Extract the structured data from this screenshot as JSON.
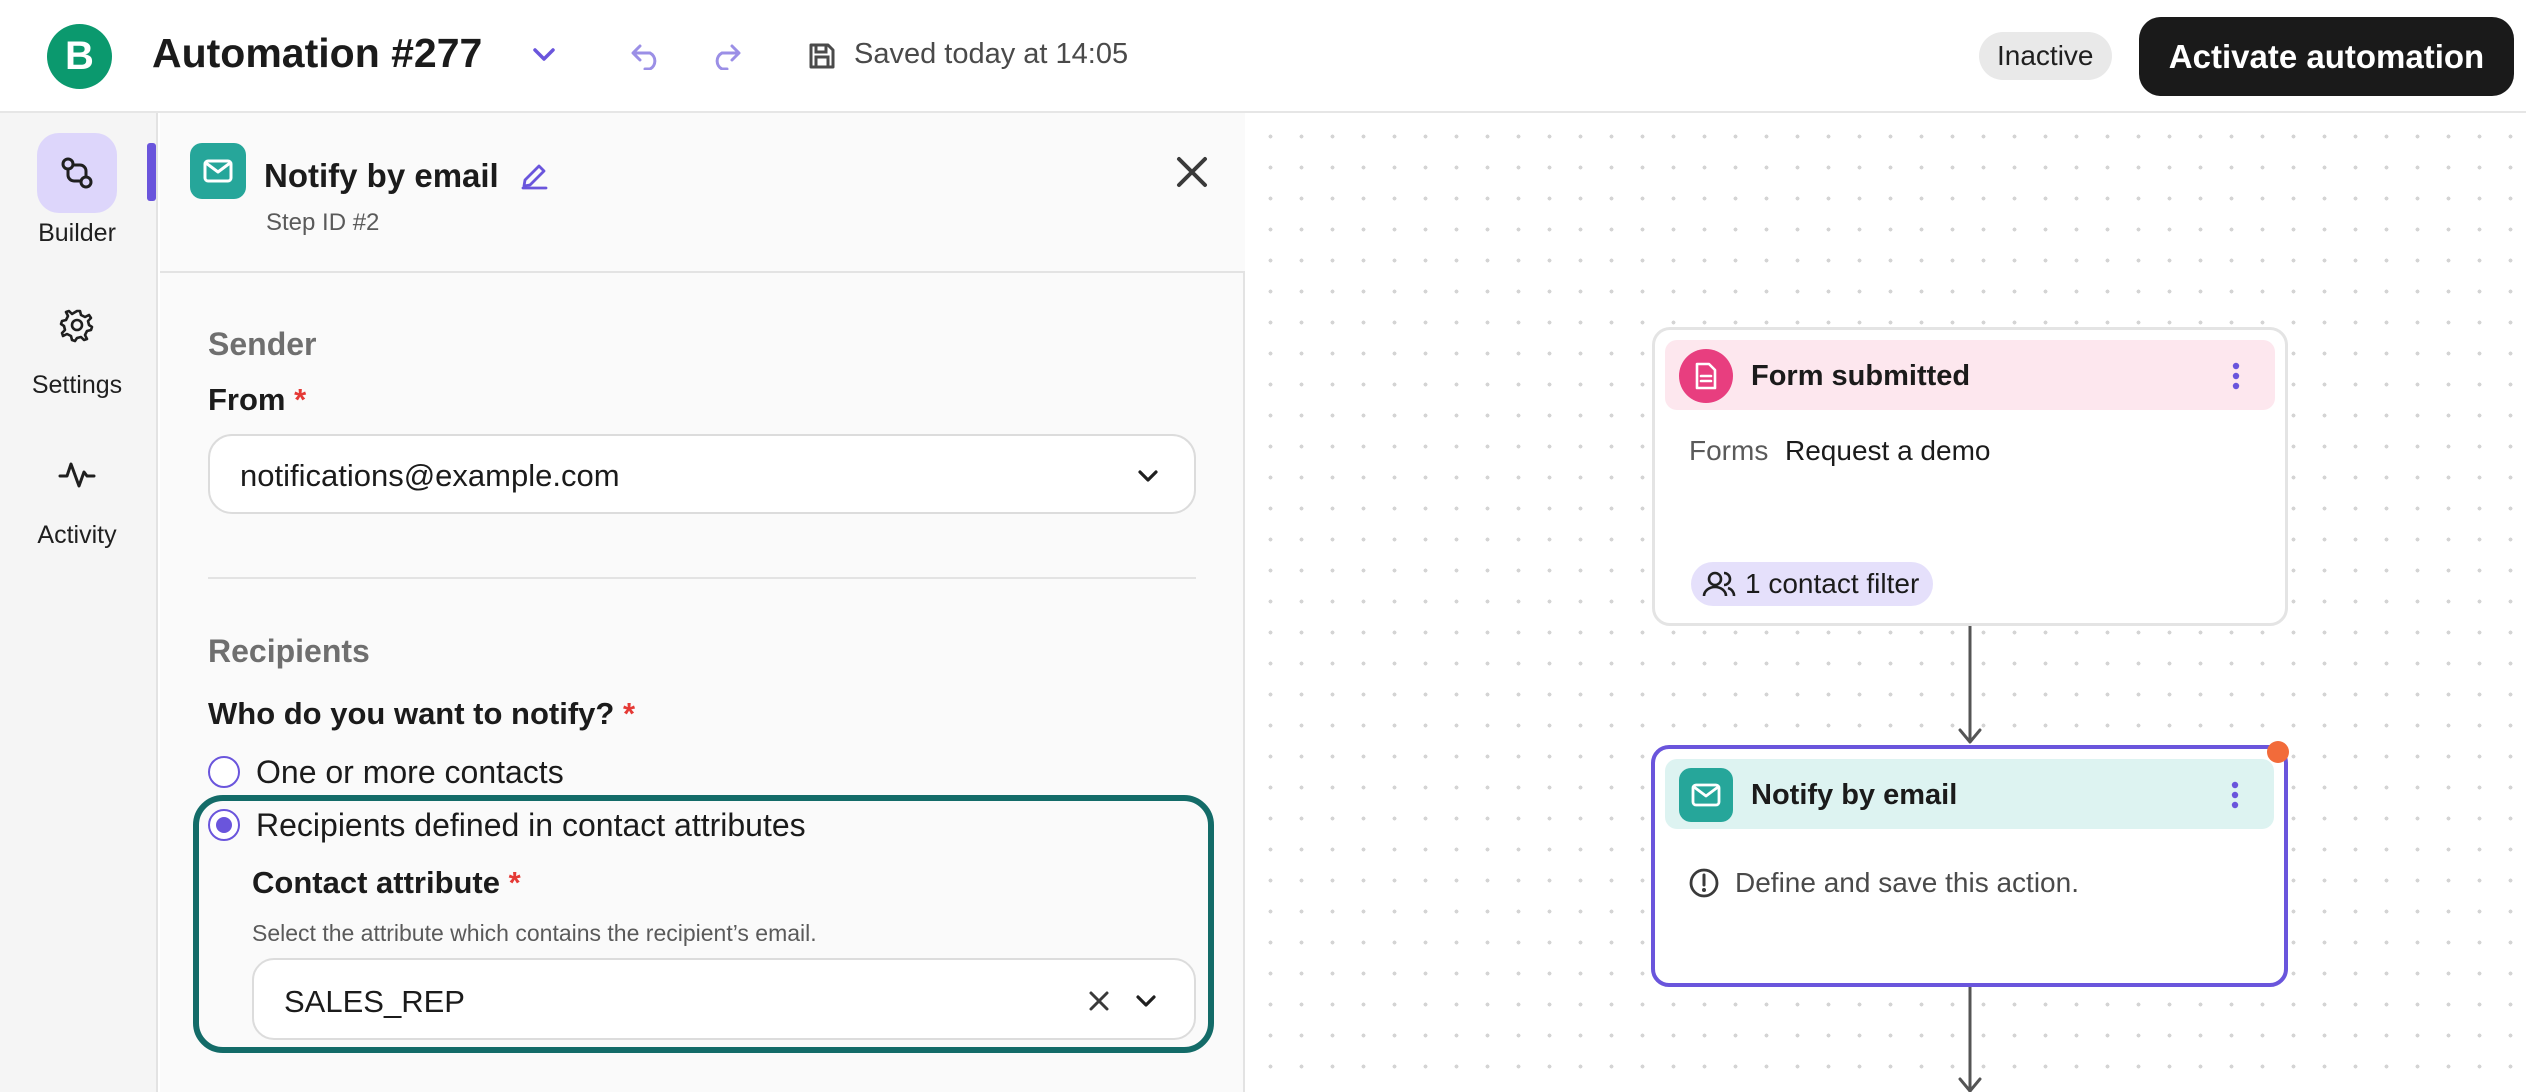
{
  "header": {
    "logo_letter": "B",
    "title": "Automation #277",
    "saved_text": "Saved today at 14:05",
    "status_badge": "Inactive",
    "activate_label": "Activate automation"
  },
  "nav": {
    "items": [
      {
        "label": "Builder",
        "icon": "builder-icon",
        "active": true
      },
      {
        "label": "Settings",
        "icon": "gear-icon",
        "active": false
      },
      {
        "label": "Activity",
        "icon": "activity-icon",
        "active": false
      }
    ]
  },
  "panel": {
    "title": "Notify by email",
    "step_id": "Step ID #2",
    "sender": {
      "section_title": "Sender",
      "from_label": "From",
      "from_value": "notifications@example.com"
    },
    "recipients": {
      "section_title": "Recipients",
      "question": "Who do you want to notify?",
      "options": [
        {
          "label": "One or more contacts",
          "selected": false
        },
        {
          "label": "Recipients defined in contact attributes",
          "selected": true
        }
      ],
      "attribute_label": "Contact attribute",
      "attribute_help": "Select the attribute which contains the recipient’s email.",
      "attribute_value": "SALES_REP"
    },
    "required_marker": "*"
  },
  "canvas": {
    "nodes": [
      {
        "title": "Form submitted",
        "icon": "form-icon",
        "key": "Forms",
        "value": "Request a demo",
        "filter": "1 contact filter"
      },
      {
        "title": "Notify by email",
        "icon": "mail-icon",
        "warning": "Define and save this action."
      }
    ]
  },
  "colors": {
    "accent": "#6a55dc",
    "brand": "#0b996e",
    "highlight_border": "#136b68",
    "form_node_accent": "#e83e7f",
    "mail_node_accent": "#26a69a",
    "unsaved_dot": "#f26b3a"
  }
}
